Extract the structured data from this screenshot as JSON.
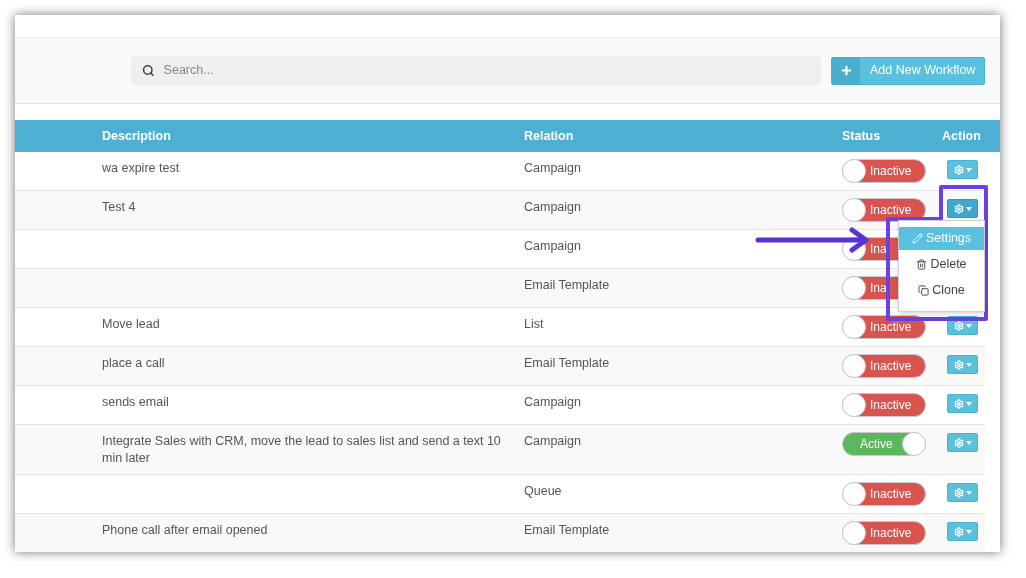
{
  "search": {
    "placeholder": "Search..."
  },
  "add_button": {
    "label": "Add New Workflow"
  },
  "table": {
    "columns": [
      "Description",
      "Relation",
      "Status",
      "Action"
    ],
    "rows": [
      {
        "description": "wa expire test",
        "relation": "Campaign",
        "status": "Inactive",
        "active": false,
        "expanded": false
      },
      {
        "description": "Test 4",
        "relation": "Campaign",
        "status": "Inactive",
        "active": false,
        "expanded": true
      },
      {
        "relation": "Campaign",
        "status": "Ina",
        "active": false
      },
      {
        "relation": "Email Template",
        "status": "Ina",
        "active": false
      },
      {
        "description": "Move lead",
        "relation": "List",
        "status": "Inactive",
        "active": false,
        "expanded": false
      },
      {
        "description": "place a call",
        "relation": "Email Template",
        "status": "Inactive",
        "active": false,
        "expanded": false
      },
      {
        "description": "sends email",
        "relation": "Campaign",
        "status": "Inactive",
        "active": false,
        "expanded": false
      },
      {
        "description": "Integrate Sales with CRM, move the lead to sales list and send a text 10 min later",
        "relation": "Campaign",
        "status": "Active",
        "active": true,
        "expanded": false
      },
      {
        "relation": "Queue",
        "status": "Inactive",
        "active": false,
        "expanded": false
      },
      {
        "description": "Phone call after email opened",
        "relation": "Email Template",
        "status": "Inactive",
        "active": false,
        "expanded": false
      }
    ]
  },
  "action_menu": [
    {
      "kind": "edit",
      "label": "Settings",
      "selected": true
    },
    {
      "kind": "delete",
      "label": "Delete",
      "selected": false
    },
    {
      "kind": "clone",
      "label": "Clone",
      "selected": false
    }
  ]
}
